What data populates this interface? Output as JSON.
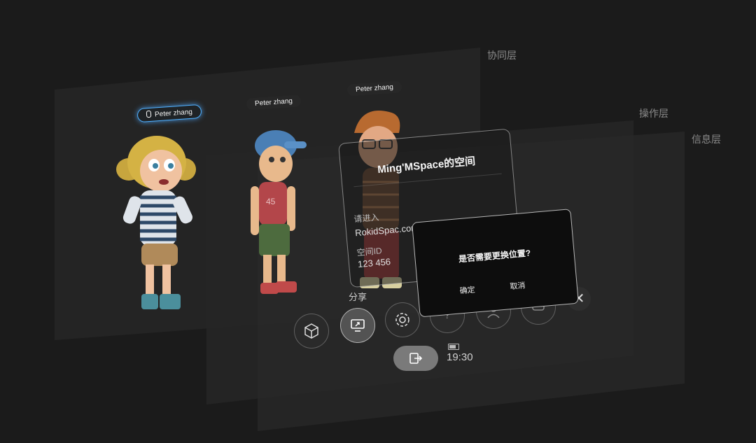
{
  "layers": {
    "collab": "协同层",
    "operation": "操作层",
    "info": "信息层"
  },
  "users": [
    {
      "name": "Peter zhang",
      "speaking": true
    },
    {
      "name": "Peter zhang",
      "speaking": false
    },
    {
      "name": "Peter zhang",
      "speaking": false
    }
  ],
  "space_card": {
    "title": "Ming'MSpace的空间",
    "instruction": "请进入",
    "url_line": "RokidSpac.com进行屏幕共享",
    "space_id_label": "空间ID",
    "space_id_value": "123 456"
  },
  "dialog": {
    "question": "是否需要更换位置?",
    "confirm": "确定",
    "cancel": "取消"
  },
  "toolbar": {
    "share_label": "分享",
    "icons": [
      "cube-icon",
      "screen-share-icon",
      "gear-icon",
      "help-icon",
      "person-icon",
      "chat-icon",
      "close-icon"
    ]
  },
  "status": {
    "time": "19:30",
    "battery_icon": "battery-icon",
    "exit_icon": "exit-icon"
  },
  "colors": {
    "background": "#1b1b1b",
    "speaking_glow": "#4fb0ff",
    "dialog_bg": "#0d0d0d"
  }
}
